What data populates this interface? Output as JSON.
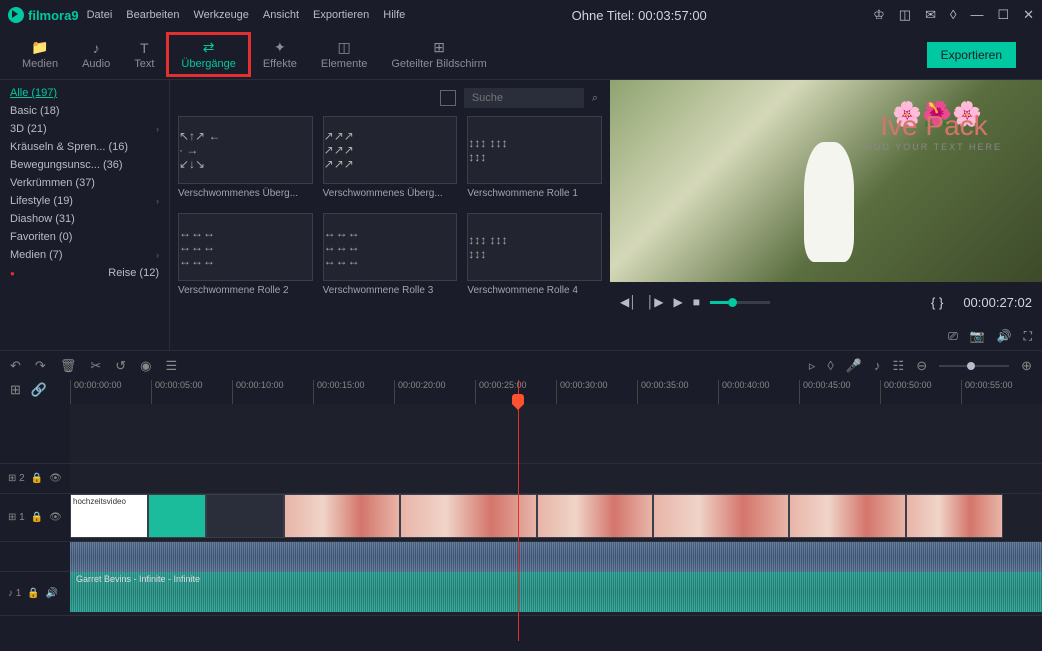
{
  "app": {
    "name": "filmora",
    "version": "9"
  },
  "menu": [
    "Datei",
    "Bearbeiten",
    "Werkzeuge",
    "Ansicht",
    "Exportieren",
    "Hilfe"
  ],
  "title": "Ohne Titel:  00:03:57:00",
  "tabs": [
    {
      "id": "medien",
      "label": "Medien",
      "icon": "📁"
    },
    {
      "id": "audio",
      "label": "Audio",
      "icon": "♪"
    },
    {
      "id": "text",
      "label": "Text",
      "icon": "T"
    },
    {
      "id": "uebergaenge",
      "label": "Übergänge",
      "icon": "⇄",
      "active": true,
      "highlighted": true
    },
    {
      "id": "effekte",
      "label": "Effekte",
      "icon": "✦"
    },
    {
      "id": "elemente",
      "label": "Elemente",
      "icon": "◫"
    },
    {
      "id": "geteilter",
      "label": "Geteilter Bildschirm",
      "icon": "⊞"
    }
  ],
  "export_label": "Exportieren",
  "sidebar": [
    {
      "label": "Alle (197)",
      "active": true
    },
    {
      "label": "Basic (18)"
    },
    {
      "label": "3D (21)",
      "chev": true
    },
    {
      "label": "Kräuseln & Spren... (16)"
    },
    {
      "label": "Bewegungsunsc... (36)"
    },
    {
      "label": "Verkrümmen (37)"
    },
    {
      "label": "Lifestyle (19)",
      "chev": true
    },
    {
      "label": "Diashow (31)"
    },
    {
      "label": "Favoriten (0)"
    },
    {
      "label": "Medien (7)",
      "chev": true
    },
    {
      "label": "Reise (12)",
      "reise": true
    }
  ],
  "search": {
    "placeholder": "Suche"
  },
  "transitions": [
    {
      "label": "Verschwommenes Überg..."
    },
    {
      "label": "Verschwommenes Überg..."
    },
    {
      "label": "Verschwommene Rolle 1"
    },
    {
      "label": "Verschwommene Rolle 2"
    },
    {
      "label": "Verschwommene Rolle 3"
    },
    {
      "label": "Verschwommene Rolle 4"
    }
  ],
  "preview": {
    "overlay_title": "Ive Pack",
    "overlay_sub": "ADD YOUR TEXT HERE",
    "timecode": "00:00:27:02",
    "braces": "{  }"
  },
  "ruler": [
    "00:00:00:00",
    "00:00:05:00",
    "00:00:10:00",
    "00:00:15:00",
    "00:00:20:00",
    "00:00:25:00",
    "00:00:30:00",
    "00:00:35:00",
    "00:00:40:00",
    "00:00:45:00",
    "00:00:50:00",
    "00:00:55:00"
  ],
  "tracks": {
    "overlay": "⊞ 2",
    "video": "⊞ 1",
    "audio": "♪ 1"
  },
  "clips": {
    "first_label": "hochzeitsvideo",
    "audio_label": "Garret Bevins - Infinite - Infinite"
  }
}
